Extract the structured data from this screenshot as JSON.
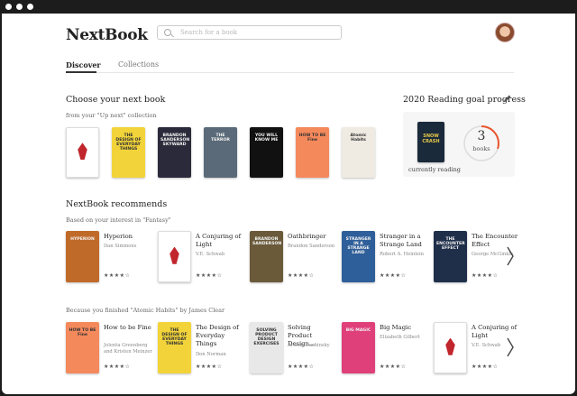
{
  "app": {
    "name": "NextBook"
  },
  "search": {
    "placeholder": "Search for a book",
    "value": ""
  },
  "tabs": [
    {
      "label": "Discover",
      "active": true
    },
    {
      "label": "Collections",
      "active": false
    }
  ],
  "up_next": {
    "heading": "Choose your next book",
    "subheading": "from your \"Up next\" collection",
    "books": [
      {
        "title": "A Conjuring of Light",
        "cover_text": "",
        "color": "#ffffff"
      },
      {
        "title": "The Design of Everyday Things",
        "cover_text": "THE DESIGN OF EVERYDAY THINGS",
        "color": "#f2d43a"
      },
      {
        "title": "Skyward",
        "cover_text": "BRANDON SANDERSON SKYWARD",
        "color": "#2a2a3a"
      },
      {
        "title": "The Terror",
        "cover_text": "THE TERROR",
        "color": "#5a6a78"
      },
      {
        "title": "You Will Know Me",
        "cover_text": "YOU WILL KNOW ME",
        "color": "#111111"
      },
      {
        "title": "How to be Fine",
        "cover_text": "HOW TO BE Fine",
        "color": "#f4895c"
      },
      {
        "title": "Atomic Habits",
        "cover_text": "Atomic Habits",
        "color": "#efeae2"
      }
    ]
  },
  "goal": {
    "heading": "2020 Reading goal progress",
    "current_label": "currently reading",
    "current_cover_text": "SNOW CRASH",
    "count": "3",
    "count_label": "books",
    "progress": 0.3,
    "accent": "#e8542e"
  },
  "recommends": {
    "heading": "NextBook recommends",
    "rows": [
      {
        "subheading": "Based on your interest in \"Fantasy\"",
        "books": [
          {
            "title": "Hyperion",
            "author": "Dan Simmons",
            "stars": "★★★★☆",
            "cover_text": "HYPERION",
            "color": "#c06a2a"
          },
          {
            "title": "A Conjuring of Light",
            "author": "V.E. Schwab",
            "stars": "★★★★☆",
            "cover_text": "",
            "color": "#ffffff"
          },
          {
            "title": "Oathbringer",
            "author": "Brandon Sanderson",
            "stars": "★★★★☆",
            "cover_text": "BRANDON SANDERSON",
            "color": "#6a5a3a"
          },
          {
            "title": "Stranger in a Strange Land",
            "author": "Robert A. Heinlein",
            "stars": "★★★★☆",
            "cover_text": "STRANGER IN A STRANGE LAND",
            "color": "#2f5f9a"
          },
          {
            "title": "The Encounter Effect",
            "author": "George McGinkle",
            "stars": "★★★★☆",
            "cover_text": "THE ENCOUNTER EFFECT",
            "color": "#1f2f4a"
          }
        ]
      },
      {
        "subheading": "Because you finished \"Atomic Habits\" by James Clear",
        "books": [
          {
            "title": "How to be Fine",
            "author": "Jolenta Greenberg and Kristen Meinzer",
            "stars": "★★★★☆",
            "cover_text": "HOW TO BE Fine",
            "color": "#f4895c"
          },
          {
            "title": "The Design of Everyday Things",
            "author": "Don Norman",
            "stars": "★★★★☆",
            "cover_text": "THE DESIGN OF EVERYDAY THINGS",
            "color": "#f2d43a"
          },
          {
            "title": "Solving Product Design...",
            "author": "Artiom Dashinsky",
            "stars": "★★★★☆",
            "cover_text": "SOLVING PRODUCT DESIGN EXERCISES",
            "color": "#e8e8e8"
          },
          {
            "title": "Big Magic",
            "author": "Elizabeth Gilbert",
            "stars": "★★★★☆",
            "cover_text": "BIG MAGIC",
            "color": "#e0407a"
          },
          {
            "title": "A Conjuring of Light",
            "author": "V.E. Schwab",
            "stars": "★★★★☆",
            "cover_text": "",
            "color": "#ffffff"
          }
        ]
      }
    ]
  }
}
